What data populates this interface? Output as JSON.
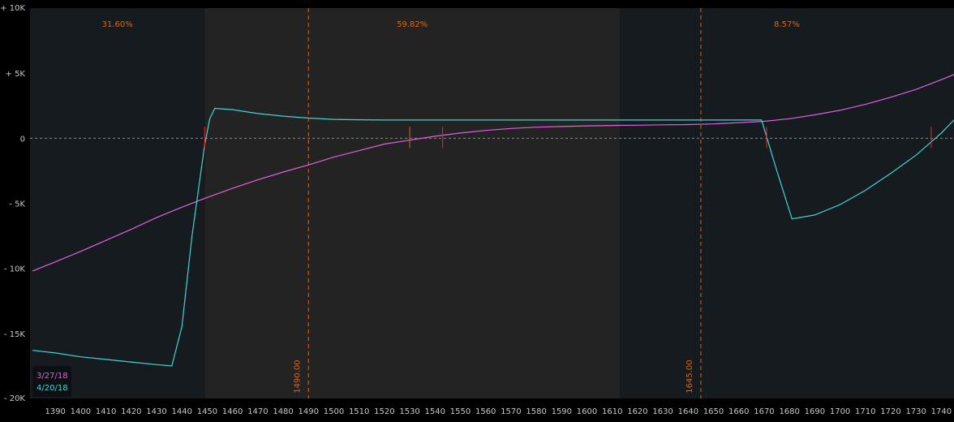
{
  "chart_data": {
    "type": "line",
    "xlim": [
      1380,
      1745
    ],
    "ylim": [
      -20000,
      10000
    ],
    "x_ticks": [
      1390,
      1400,
      1410,
      1420,
      1430,
      1440,
      1450,
      1460,
      1470,
      1480,
      1490,
      1500,
      1510,
      1520,
      1530,
      1540,
      1550,
      1560,
      1570,
      1580,
      1590,
      1600,
      1610,
      1620,
      1630,
      1640,
      1650,
      1660,
      1670,
      1680,
      1690,
      1700,
      1710,
      1720,
      1730,
      1740
    ],
    "y_ticks": [
      {
        "value": 10000,
        "label": "+ 10K"
      },
      {
        "value": 5000,
        "label": "+ 5K"
      },
      {
        "value": 0,
        "label": "0"
      },
      {
        "value": -5000,
        "label": "- 5K"
      },
      {
        "value": -10000,
        "label": "- 10K"
      },
      {
        "value": -15000,
        "label": "- 15K"
      },
      {
        "value": -20000,
        "label": "- 20K"
      }
    ],
    "zero_line": 0,
    "probability_zones": [
      {
        "from": 1380,
        "to": 1449,
        "label": "31.60%",
        "color": "#161b20"
      },
      {
        "from": 1449,
        "to": 1613,
        "label": "59.82%",
        "color": "#232323"
      },
      {
        "from": 1613,
        "to": 1745,
        "label": "8.57%",
        "color": "#161b20"
      }
    ],
    "strike_lines": [
      {
        "x": 1490,
        "label": "1490.00"
      },
      {
        "x": 1645,
        "label": "1645.00"
      }
    ],
    "series": [
      {
        "name": "3/27/18",
        "color": "#e060e0",
        "x": [
          1381,
          1390,
          1400,
          1410,
          1420,
          1430,
          1440,
          1450,
          1460,
          1470,
          1480,
          1490,
          1500,
          1510,
          1520,
          1530,
          1540,
          1550,
          1560,
          1570,
          1580,
          1590,
          1600,
          1610,
          1620,
          1630,
          1640,
          1650,
          1660,
          1670,
          1680,
          1690,
          1700,
          1710,
          1720,
          1730,
          1740,
          1745
        ],
        "y": [
          -10200,
          -9500,
          -8700,
          -7850,
          -7000,
          -6100,
          -5300,
          -4550,
          -3850,
          -3200,
          -2600,
          -2050,
          -1450,
          -950,
          -450,
          -150,
          150,
          400,
          600,
          750,
          850,
          900,
          950,
          980,
          1000,
          1030,
          1050,
          1100,
          1200,
          1300,
          1500,
          1800,
          2150,
          2600,
          3150,
          3750,
          4500,
          4900
        ]
      },
      {
        "name": "4/20/18",
        "color": "#3ed6d6",
        "x": [
          1381,
          1390,
          1400,
          1410,
          1420,
          1430,
          1436,
          1440,
          1444,
          1449,
          1451,
          1453,
          1460,
          1470,
          1480,
          1490,
          1500,
          1510,
          1520,
          1530,
          1540,
          1560,
          1580,
          1600,
          1620,
          1640,
          1660,
          1669,
          1675,
          1681,
          1690,
          1700,
          1710,
          1720,
          1730,
          1740,
          1745
        ],
        "y": [
          -16300,
          -16500,
          -16800,
          -17000,
          -17200,
          -17400,
          -17500,
          -14500,
          -7500,
          -500,
          1500,
          2300,
          2200,
          1900,
          1700,
          1550,
          1450,
          1420,
          1400,
          1400,
          1400,
          1400,
          1400,
          1400,
          1400,
          1400,
          1400,
          1400,
          -2500,
          -6200,
          -5900,
          -5100,
          -4000,
          -2700,
          -1300,
          400,
          1400
        ]
      }
    ],
    "markers": [
      {
        "x": 1449,
        "y": 0,
        "color": "#ff2020"
      },
      {
        "x": 1530,
        "y": 0,
        "color": "#d2691e"
      },
      {
        "x": 1543,
        "y": 0,
        "color": "#ff2020"
      },
      {
        "x": 1671,
        "y": 0,
        "color": "#ff2020"
      },
      {
        "x": 1736,
        "y": 0,
        "color": "#ff2020"
      }
    ],
    "legend": {
      "placement": "bottom-left",
      "entries": [
        {
          "label": "3/27/18",
          "color": "#e060e0"
        },
        {
          "label": "4/20/18",
          "color": "#3ed6d6"
        }
      ]
    },
    "grid": false,
    "colors": {
      "background": "#000000",
      "axis_text": "#c8c8c8",
      "zone_text": "#d2691e",
      "zero_line": "#8a8a8a"
    }
  }
}
